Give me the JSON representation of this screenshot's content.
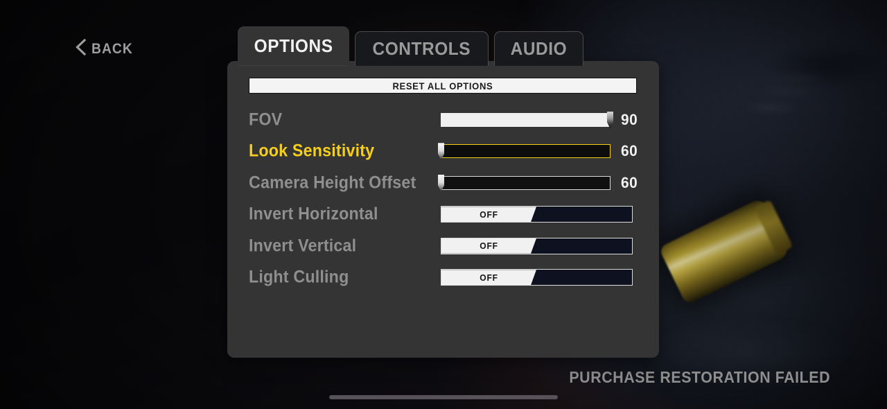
{
  "screen": {
    "title": "Game Options Menu",
    "accent_color": "#f5cf1b",
    "panel_color": "#343434",
    "label_color": "#8f8f8f"
  },
  "back_button": {
    "label": "BACK",
    "icon": "chevron-left-icon"
  },
  "tabs": [
    {
      "label": "OPTIONS",
      "active": true
    },
    {
      "label": "CONTROLS",
      "active": false
    },
    {
      "label": "AUDIO",
      "active": false
    }
  ],
  "reset_button": {
    "label": "RESET ALL OPTIONS"
  },
  "settings": [
    {
      "label": "FOV",
      "type": "slider",
      "value": "90",
      "fill_percent": 100,
      "selected": false
    },
    {
      "label": "Look Sensitivity",
      "type": "slider",
      "value": "60",
      "fill_percent": 0,
      "selected": true
    },
    {
      "label": "Camera Height Offset",
      "type": "slider",
      "value": "60",
      "fill_percent": 0,
      "selected": false
    },
    {
      "label": "Invert Horizontal",
      "type": "toggle",
      "value": "OFF",
      "selected": false
    },
    {
      "label": "Invert Vertical",
      "type": "toggle",
      "value": "OFF",
      "selected": false
    },
    {
      "label": "Light Culling",
      "type": "toggle",
      "value": "OFF",
      "selected": false
    }
  ],
  "status": {
    "message": "PURCHASE RESTORATION FAILED"
  },
  "background": {
    "art_description": "dark scene with claw silhouette and golden bullet casing"
  }
}
